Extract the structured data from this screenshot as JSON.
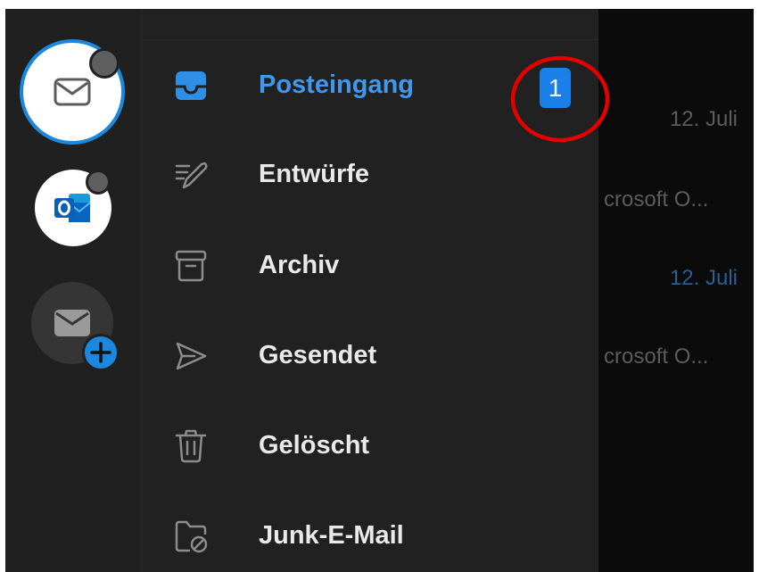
{
  "menu": {
    "items": [
      {
        "label": "Posteingang",
        "icon": "inbox-icon"
      },
      {
        "label": "Entwürfe",
        "icon": "drafts-icon"
      },
      {
        "label": "Archiv",
        "icon": "archive-icon"
      },
      {
        "label": "Gesendet",
        "icon": "sent-icon"
      },
      {
        "label": "Gelöscht",
        "icon": "trash-icon"
      },
      {
        "label": "Junk-E-Mail",
        "icon": "junk-folder-icon"
      }
    ],
    "inbox_unread_count": "1"
  },
  "accounts": [
    {
      "icon": "mail-icon",
      "selected": true
    },
    {
      "icon": "outlook-logo-icon",
      "selected": false
    },
    {
      "icon": "add-account-icon",
      "selected": false
    }
  ],
  "background_list": {
    "dates": [
      "12. Juli",
      "12. Juli"
    ],
    "senders": [
      "crosoft O...",
      "crosoft O..."
    ]
  },
  "colors": {
    "accent": "#1b88e0",
    "active_text": "#3e98ee",
    "annotation": "#e30000"
  }
}
